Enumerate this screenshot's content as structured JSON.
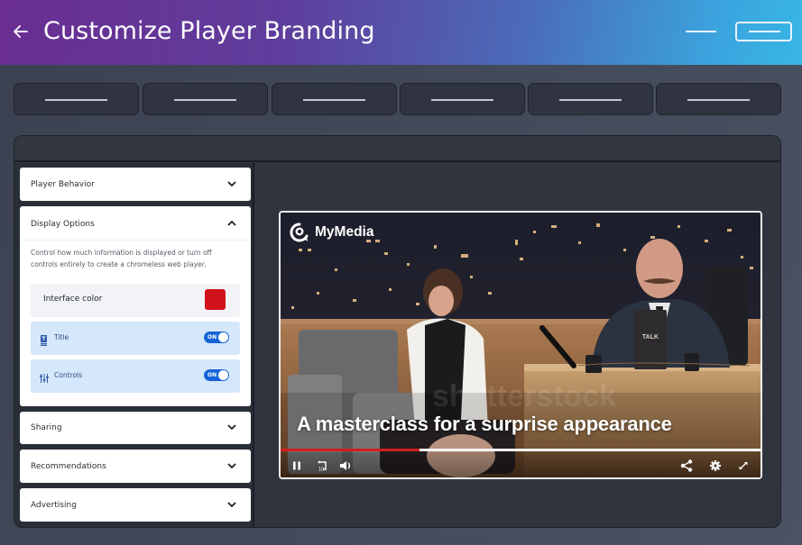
{
  "header": {
    "title": "Customize Player Branding",
    "back_icon": "arrow-left-icon",
    "colors": {
      "gradient_start": "#6a2e92",
      "gradient_end": "#38b6e6"
    }
  },
  "tabs": [
    {
      "label": ""
    },
    {
      "label": ""
    },
    {
      "label": ""
    },
    {
      "label": ""
    },
    {
      "label": ""
    },
    {
      "label": ""
    }
  ],
  "sidebar": {
    "sections": [
      {
        "label": "Player Behavior",
        "expanded": false,
        "icon": "chevron-down-icon"
      },
      {
        "label": "Display Options",
        "expanded": true,
        "icon": "chevron-up-icon",
        "description": "Control how much information is displayed or turn off controls entirely to create a chromeless web player.",
        "interface_color": {
          "label": "Interface color",
          "value": "#d0131a"
        },
        "toggles": [
          {
            "label": "Title",
            "icon": "title-icon",
            "state": "ON",
            "on": true
          },
          {
            "label": "Controls",
            "icon": "sliders-icon",
            "state": "ON",
            "on": true
          }
        ]
      },
      {
        "label": "Sharing",
        "expanded": false,
        "icon": "chevron-down-icon"
      },
      {
        "label": "Recommendations",
        "expanded": false,
        "icon": "chevron-down-icon"
      },
      {
        "label": "Advertising",
        "expanded": false,
        "icon": "chevron-down-icon"
      }
    ]
  },
  "player": {
    "brand_name": "MyMedia",
    "brand_icon": "mymedia-logo-icon",
    "video_title": "A masterclass for a surprise appearance",
    "progress_percent": 29,
    "progress_color": "#d21d1d",
    "controls": {
      "left": [
        "pause-icon",
        "replay-10-icon",
        "volume-icon"
      ],
      "right": [
        "share-icon",
        "settings-icon",
        "fullscreen-icon"
      ]
    },
    "watermark": "shutterstock"
  }
}
